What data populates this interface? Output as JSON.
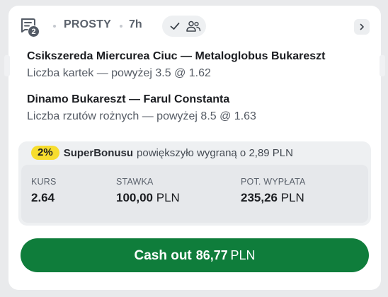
{
  "header": {
    "bet_count": "2",
    "bet_type": "PROSTY",
    "time_ago": "7h",
    "icons": [
      "betslip-icon",
      "check-icon",
      "users-icon",
      "chevron-right-icon"
    ]
  },
  "selections": [
    {
      "match": "Csikszereda Miercurea Ciuc — Metaloglobus Bukareszt",
      "market": "Liczba kartek — powyżej 3.5 @ 1.62"
    },
    {
      "match": "Dinamo Bukareszt — Farul Constanta",
      "market": "Liczba rzutów rożnych — powyżej 8.5 @ 1.63"
    }
  ],
  "bonus": {
    "percent": "2%",
    "name": "SuperBonusu",
    "text": "powiększyło wygraną o 2,89 PLN"
  },
  "stats": {
    "odds_label": "KURS",
    "odds_value": "2.64",
    "stake_label": "STAWKA",
    "stake_value": "100,00",
    "stake_currency": "PLN",
    "payout_label": "POT. WYPŁATA",
    "payout_value": "235,26",
    "payout_currency": "PLN"
  },
  "cashout": {
    "label": "Cash out",
    "amount": "86,77",
    "currency": "PLN"
  },
  "colors": {
    "brand_green": "#0f7d3b",
    "bonus_yellow": "#f7dd2e"
  }
}
